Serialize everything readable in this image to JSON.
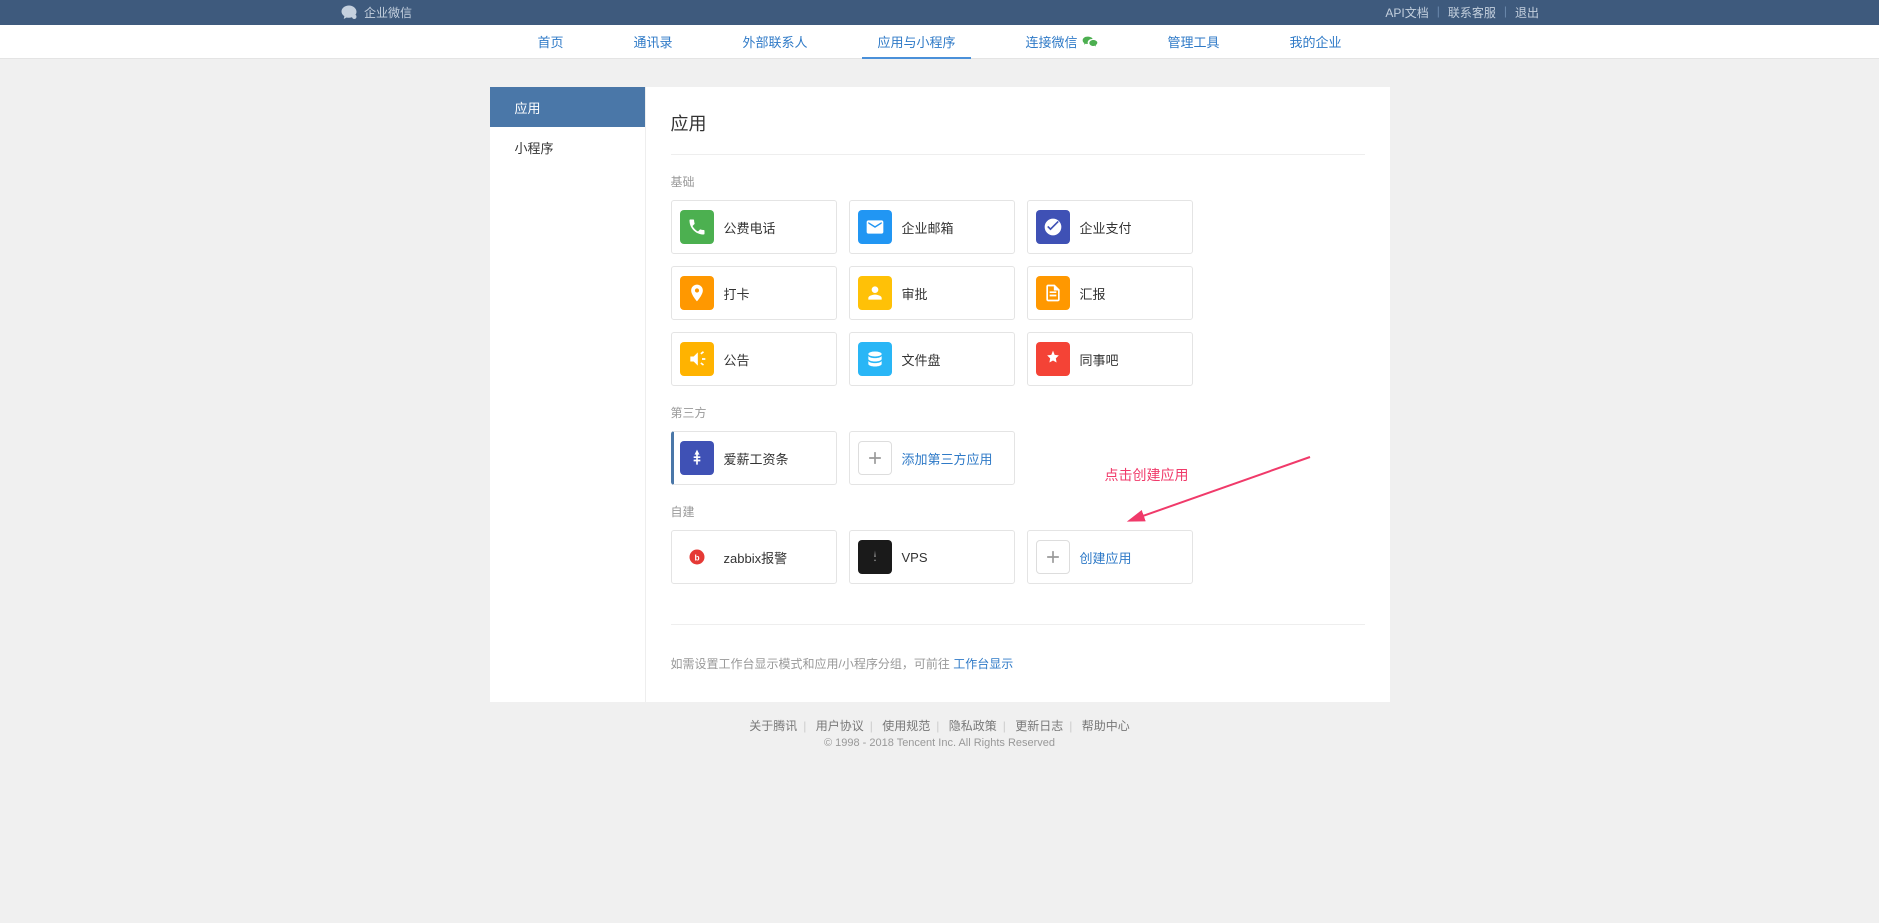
{
  "topbar": {
    "brand": "企业微信",
    "links": {
      "api": "API文档",
      "contact": "联系客服",
      "logout": "退出"
    }
  },
  "nav": {
    "home": "首页",
    "contacts": "通讯录",
    "external": "外部联系人",
    "apps": "应用与小程序",
    "connect": "连接微信",
    "tools": "管理工具",
    "company": "我的企业"
  },
  "sidebar": {
    "apps": "应用",
    "mini": "小程序"
  },
  "main": {
    "title": "应用",
    "sections": {
      "basic": "基础",
      "third": "第三方",
      "self": "自建"
    },
    "basic": {
      "phone": "公费电话",
      "mail": "企业邮箱",
      "pay": "企业支付",
      "checkin": "打卡",
      "approve": "审批",
      "report": "汇报",
      "announce": "公告",
      "drive": "文件盘",
      "colleague": "同事吧"
    },
    "third": {
      "payroll": "爱薪工资条",
      "add": "添加第三方应用"
    },
    "self": {
      "zabbix": "zabbix报警",
      "vps": "VPS",
      "create": "创建应用"
    },
    "note_prefix": "如需设置工作台显示模式和应用/小程序分组，可前往",
    "note_link": "工作台显示"
  },
  "annotation": "点击创建应用",
  "footer": {
    "about": "关于腾讯",
    "agreement": "用户协议",
    "usage": "使用规范",
    "privacy": "隐私政策",
    "changelog": "更新日志",
    "help": "帮助中心",
    "copyright": "© 1998 - 2018 Tencent Inc. All Rights Reserved"
  }
}
